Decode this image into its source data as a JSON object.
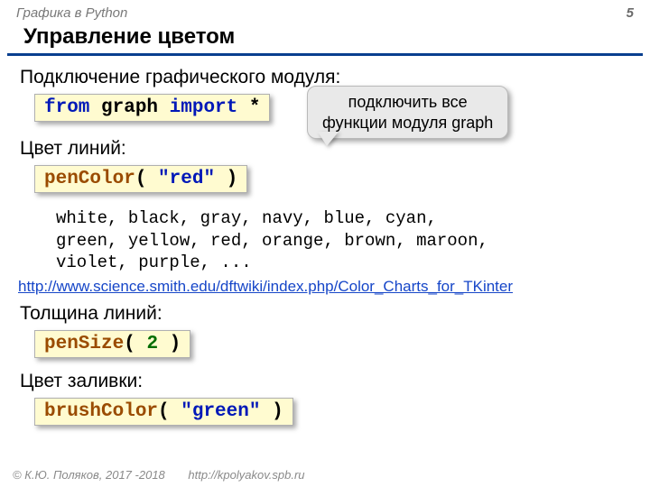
{
  "header": {
    "topic": "Графика в Python",
    "page": "5"
  },
  "title": "Управление цветом",
  "sections": {
    "include": {
      "label": "Подключение графического модуля:",
      "code": {
        "kw1": "from",
        "mod": " graph ",
        "kw2": "import",
        "star": " *"
      }
    },
    "callout": {
      "line1": "подключить все",
      "line2": "функции модуля graph"
    },
    "penColor": {
      "label": "Цвет линий:",
      "fn": "penColor",
      "open": "( ",
      "arg": "\"red\"",
      "close": " )"
    },
    "colors": "white, black, gray, navy, blue, cyan,\ngreen, yellow, red, orange, brown, maroon,\nviolet, purple, ...",
    "link": "http://www.science.smith.edu/dftwiki/index.php/Color_Charts_for_TKinter",
    "penSize": {
      "label": "Толщина линий:",
      "fn": "penSize",
      "open": "( ",
      "arg": "2",
      "close": " )"
    },
    "brushColor": {
      "label": "Цвет заливки:",
      "fn": "brushColor",
      "open": "( ",
      "arg": "\"green\"",
      "close": " )"
    }
  },
  "footer": {
    "copyright": "© К.Ю. Поляков, 2017 -2018",
    "url": "http://kpolyakov.spb.ru"
  }
}
